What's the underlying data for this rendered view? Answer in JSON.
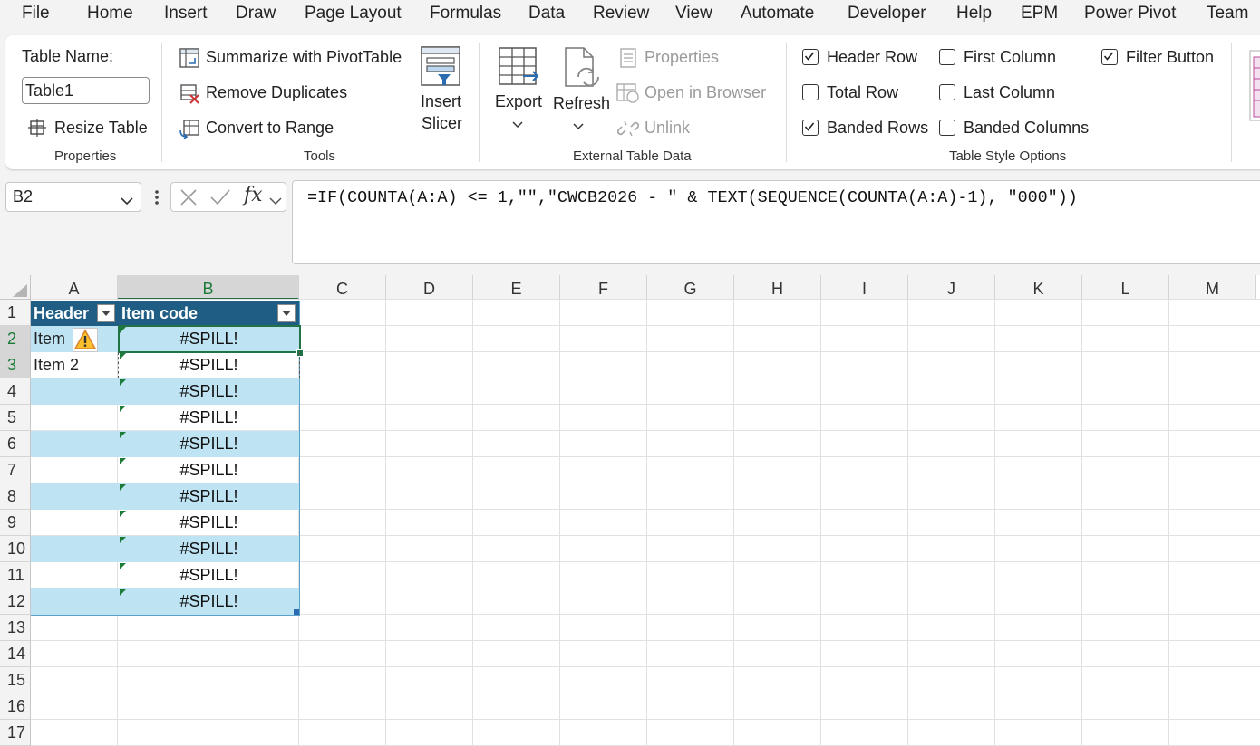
{
  "menu": [
    "File",
    "Home",
    "Insert",
    "Draw",
    "Page Layout",
    "Formulas",
    "Data",
    "Review",
    "View",
    "Automate",
    "Developer",
    "Help",
    "EPM",
    "Power Pivot",
    "Team"
  ],
  "ribbon": {
    "properties": {
      "table_name_label": "Table Name:",
      "table_name_value": "Table1",
      "resize_label": "Resize Table",
      "group_label": "Properties"
    },
    "tools": {
      "summarize": "Summarize with PivotTable",
      "remove_duplicates": "Remove Duplicates",
      "convert_to_range": "Convert to Range",
      "insert_slicer_line1": "Insert",
      "insert_slicer_line2": "Slicer",
      "group_label": "Tools"
    },
    "external": {
      "export": "Export",
      "refresh": "Refresh",
      "properties": "Properties",
      "open_in_browser": "Open in Browser",
      "unlink": "Unlink",
      "group_label": "External Table Data"
    },
    "style_options": {
      "header_row": {
        "label": "Header Row",
        "checked": true
      },
      "total_row": {
        "label": "Total Row",
        "checked": false
      },
      "banded_rows": {
        "label": "Banded Rows",
        "checked": true
      },
      "first_column": {
        "label": "First Column",
        "checked": false
      },
      "last_column": {
        "label": "Last Column",
        "checked": false
      },
      "banded_columns": {
        "label": "Banded Columns",
        "checked": false
      },
      "filter_button": {
        "label": "Filter Button",
        "checked": true
      },
      "group_label": "Table Style Options"
    }
  },
  "formula_bar": {
    "name_box": "B2",
    "fx": "fx",
    "formula": "=IF(COUNTA(A:A) <= 1,\"\",\"CWCB2026 - \" & TEXT(SEQUENCE(COUNTA(A:A)-1), \"000\"))"
  },
  "sheet": {
    "columns": [
      "A",
      "B",
      "C",
      "D",
      "E",
      "F",
      "G",
      "H",
      "I",
      "J",
      "K",
      "L",
      "M"
    ],
    "rows": [
      "1",
      "2",
      "3",
      "4",
      "5",
      "6",
      "7",
      "8",
      "9",
      "10",
      "11",
      "12",
      "13",
      "14",
      "15",
      "16",
      "17"
    ],
    "table_headers": [
      "Header",
      "Item code"
    ],
    "col_a_values": [
      "Item",
      "Item 2"
    ],
    "col_b_values": [
      "#SPILL!",
      "#SPILL!",
      "#SPILL!",
      "#SPILL!",
      "#SPILL!",
      "#SPILL!",
      "#SPILL!",
      "#SPILL!",
      "#SPILL!",
      "#SPILL!",
      "#SPILL!"
    ]
  },
  "colors": {
    "table_header": "#1f5d84",
    "band": "#bee3f3",
    "selection": "#217346",
    "error_triangle": "#1d7b3a"
  }
}
